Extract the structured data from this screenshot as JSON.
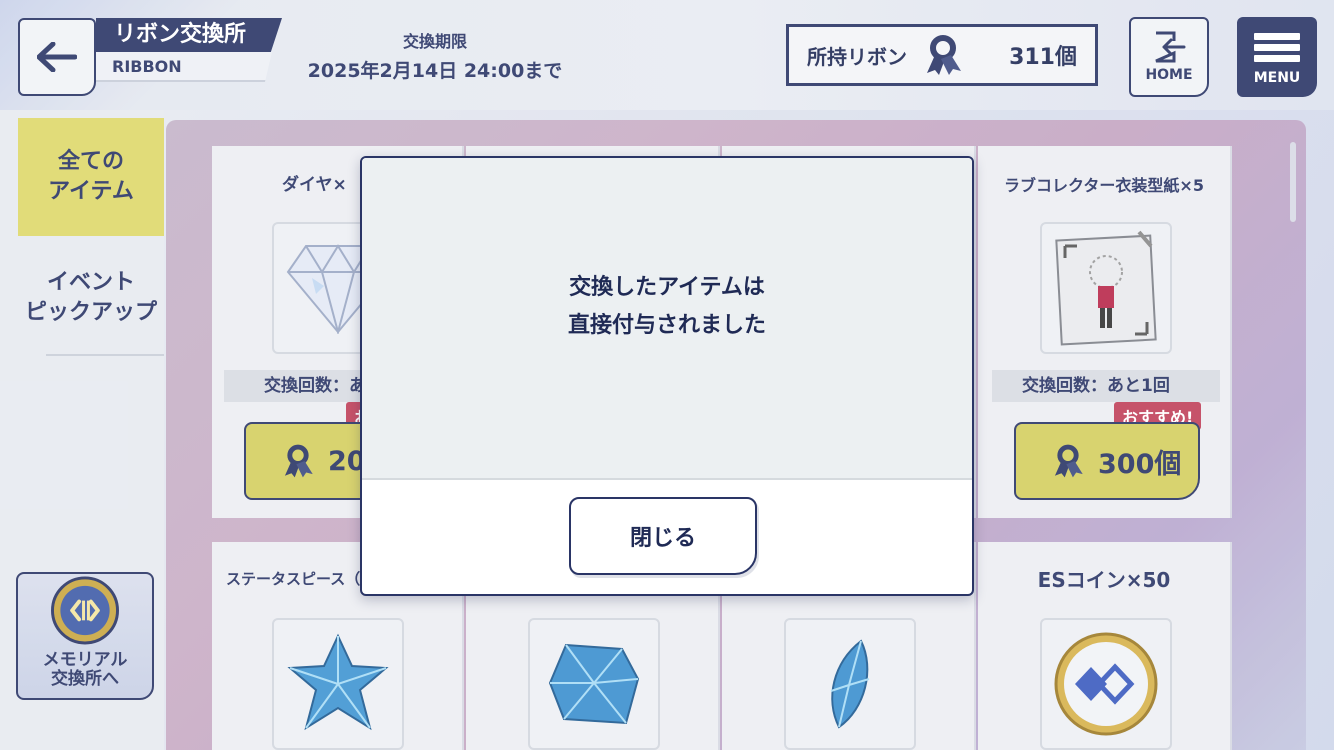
{
  "header": {
    "back_icon": "arrow-left-icon",
    "title": "リボン交換所",
    "subtitle": "RIBBON",
    "deadline_label": "交換期限",
    "deadline_value": "2025年2月14日 24:00まで",
    "ribbon_label": "所持リボン",
    "ribbon_count": "311個",
    "home_label": "HOME",
    "menu_label": "MENU"
  },
  "sidebar": {
    "tab_all": "全ての\nアイテム",
    "tab_event": "イベント\nピックアップ",
    "memorial": "メモリアル\n交換所へ"
  },
  "items": [
    {
      "name": "ダイヤ×",
      "count": "交換回数：あ",
      "price": "20",
      "badge": "お"
    },
    {
      "name": "ラブコレクター衣装型紙×5",
      "count": "交換回数：あと1回",
      "price": "300個",
      "badge": "おすすめ!"
    },
    {
      "name": "ステータスピース（",
      "icon": "star-crystal-icon"
    },
    {
      "name": "",
      "icon": "square-crystal-icon"
    },
    {
      "name": "",
      "icon": "leaf-crystal-icon"
    },
    {
      "name": "ESコイン×50",
      "icon": "es-coin-icon"
    }
  ],
  "modal": {
    "message_line1": "交換したアイテムは",
    "message_line2": "直接付与されました",
    "close_label": "閉じる"
  },
  "colors": {
    "navy": "#2a3566",
    "yellow": "#d4cf5f",
    "badge_red": "#c0405a",
    "modal_body": "#ecf0f2"
  }
}
